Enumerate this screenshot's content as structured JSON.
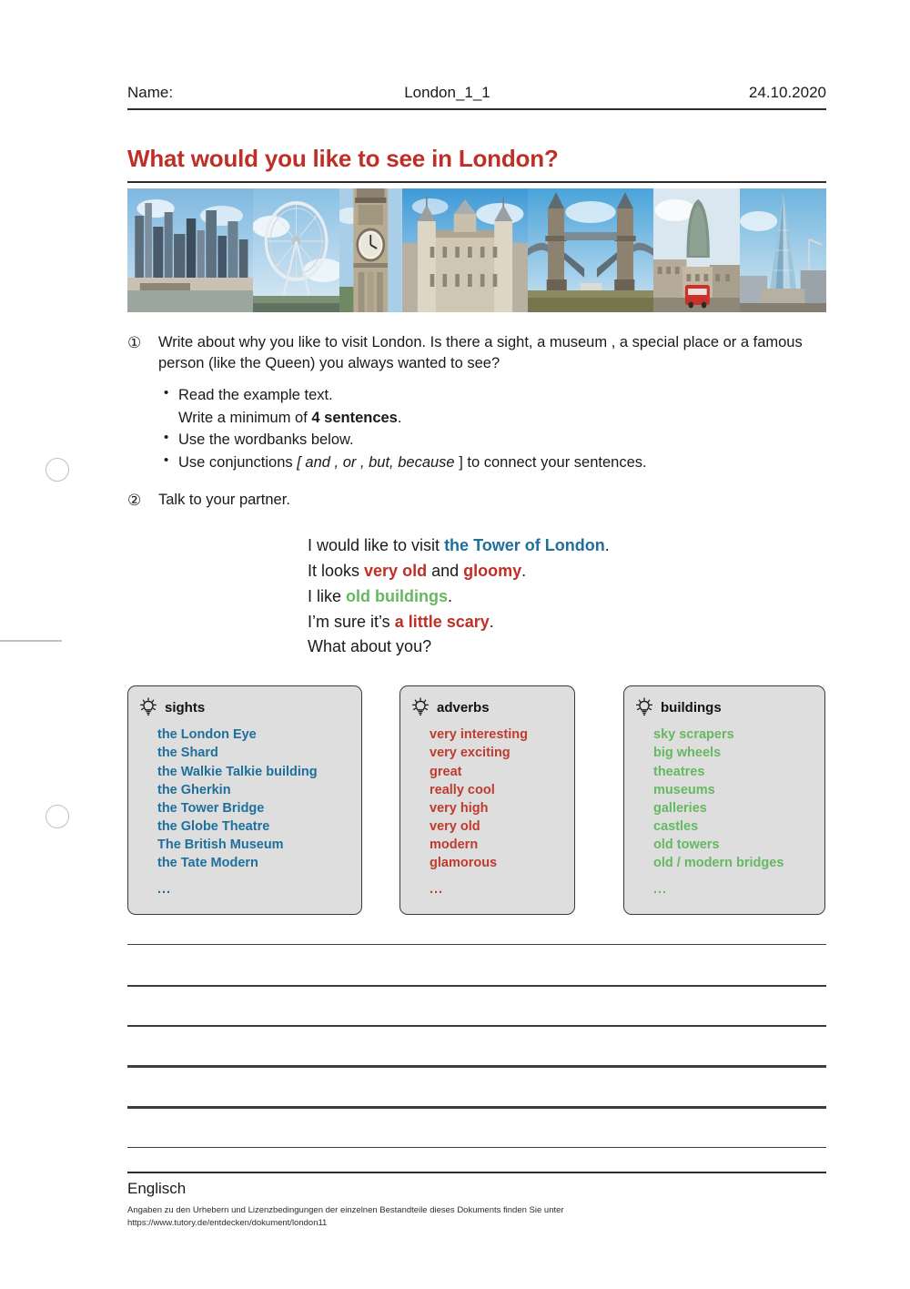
{
  "header": {
    "name_label": "Name:",
    "document_title": "London_1_1",
    "date": "24.10.2020"
  },
  "title": "What would you like to see in London?",
  "image_strip": {
    "panels": [
      {
        "name": "city-skyline-photo",
        "caption": "London City skyline"
      },
      {
        "name": "london-eye-photo",
        "caption": "The London Eye"
      },
      {
        "name": "big-ben-photo",
        "caption": "Big Ben clock tower"
      },
      {
        "name": "tower-of-london-photo",
        "caption": "The Tower of London"
      },
      {
        "name": "tower-bridge-photo",
        "caption": "Tower Bridge raised"
      },
      {
        "name": "gherkin-photo",
        "caption": "The Gherkin and red bus"
      },
      {
        "name": "shard-photo",
        "caption": "The Shard"
      }
    ]
  },
  "tasks": [
    {
      "number": "①",
      "text": "Write about why you like to visit London. Is there a sight, a museum , a special place or a famous person (like the Queen) you always wanted to see?",
      "bullets": [
        {
          "type": "bullet",
          "prefix": "Read the example text.",
          "bold": "",
          "suffix": ""
        },
        {
          "type": "cont",
          "prefix": "Write a minimum of ",
          "bold": "4 sentences",
          "suffix": "."
        },
        {
          "type": "bullet",
          "prefix": "Use the wordbanks below.",
          "bold": "",
          "suffix": ""
        },
        {
          "type": "bullet-italic",
          "prefix": "Use conjunctions ",
          "italic": "[ and , or , but, because ",
          "suffix": "] to connect your sentences."
        }
      ]
    },
    {
      "number": "②",
      "text": "Talk to your partner.",
      "bullets": []
    }
  ],
  "example_text": {
    "lines": [
      [
        {
          "t": "I would like to visit ",
          "c": "plain"
        },
        {
          "t": "the Tower of London",
          "c": "blue"
        },
        {
          "t": ".",
          "c": "plain"
        }
      ],
      [
        {
          "t": "It looks ",
          "c": "plain"
        },
        {
          "t": "very old",
          "c": "red"
        },
        {
          "t": " and ",
          "c": "plain"
        },
        {
          "t": "gloomy",
          "c": "red"
        },
        {
          "t": ".",
          "c": "plain"
        }
      ],
      [
        {
          "t": "I like ",
          "c": "plain"
        },
        {
          "t": "old buildings",
          "c": "green"
        },
        {
          "t": ".",
          "c": "plain"
        }
      ],
      [
        {
          "t": "I’m sure it’s ",
          "c": "plain"
        },
        {
          "t": "a little scary",
          "c": "red"
        },
        {
          "t": ".",
          "c": "plain"
        }
      ],
      [
        {
          "t": "What about you?",
          "c": "plain"
        }
      ]
    ]
  },
  "wordbanks": [
    {
      "title": "sights",
      "icon": "lightbulb-icon",
      "color": "#1f6f9c",
      "items": [
        "the London Eye",
        "the Shard",
        "the Walkie Talkie building",
        "the Gherkin",
        "the Tower Bridge",
        "the Globe Theatre",
        "The British Museum",
        "the Tate Modern"
      ],
      "more": "..."
    },
    {
      "title": "adverbs",
      "icon": "lightbulb-icon",
      "color": "#bf3b2e",
      "items": [
        "very interesting",
        "very exciting",
        "great",
        "really cool",
        "very high",
        "very old",
        "modern",
        "glamorous"
      ],
      "more": "..."
    },
    {
      "title": "buildings",
      "icon": "lightbulb-icon",
      "color": "#66b862",
      "items": [
        "sky scrapers",
        "big wheels",
        "theatres",
        "museums",
        "galleries",
        "castles",
        "old towers",
        "old / modern bridges"
      ],
      "more": "..."
    }
  ],
  "writing_lines": {
    "count": 6,
    "weights": [
      "thin",
      "thin",
      "thick",
      "thick",
      "thick",
      "thin"
    ]
  },
  "footer": {
    "subject": "Englisch",
    "legal_line_1": "Angaben zu den Urhebern und Lizenzbedingungen der einzelnen Bestandteile dieses Dokuments finden Sie unter",
    "legal_line_2": "https://www.tutory.de/entdecken/dokument/london11"
  },
  "colors": {
    "title_red": "#bf2f26",
    "sights_blue": "#1f6f9c",
    "adverbs_red": "#bf3b2e",
    "buildings_green": "#66b862",
    "wordbank_bg": "#dedede",
    "rule_dark": "#2b2b2b"
  }
}
